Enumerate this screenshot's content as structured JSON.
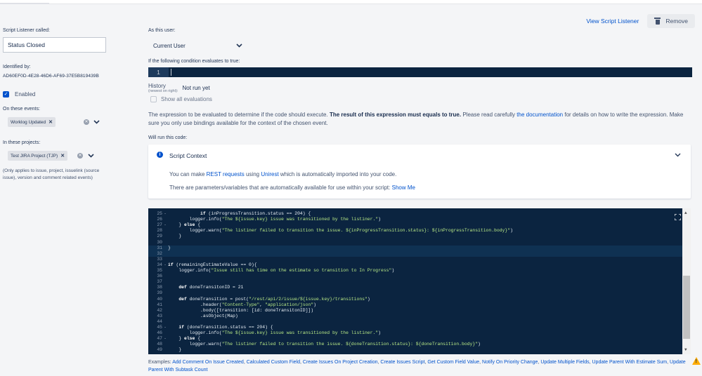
{
  "header": {
    "view_listener": "View Script Listener",
    "remove": "Remove"
  },
  "left": {
    "called_label": "Script Listener called:",
    "called_value": "Status Closed",
    "identified_label": "Identified by:",
    "identified_value": "AD60EF0D-4E28-46D6-AF69-37E5B819439B",
    "enabled_label": "Enabled",
    "events_label": "On these events:",
    "event_chip": "Worklog Updated",
    "projects_label": "In these projects:",
    "project_chip": "Test JIRA Project (TJP)",
    "projects_note": "(Only applies to issue, project, issuelink (source issue), version and comment related events)"
  },
  "main": {
    "user_label": "As this user:",
    "user_value": "Current User",
    "condition_label": "If the following condition evaluates to true:",
    "condition_line": "1",
    "history_label": "History",
    "history_sub": "(newest on right):",
    "history_value": "Not run yet",
    "show_evals": "Show all evaluations",
    "desc_1": "The expression to be evaluated to determine if the code should execute.",
    "desc_bold": "The result of this expression must equals to true.",
    "desc_2": "Please read carefully",
    "desc_link": "the documentation",
    "desc_3": "for details on how to write the expression. Make sure you only use bindings available for the context of the chosen event.",
    "run_label": "Will run this code:"
  },
  "context": {
    "title": "Script Context",
    "line1_a": "You can make",
    "line1_link1": "REST requests",
    "line1_b": "using",
    "line1_link2": "Unirest",
    "line1_c": "which is automatically imported into your code.",
    "line2": "There are parameters/variables that are automatically available for use within your script:",
    "line2_link": "Show Me"
  },
  "code": [
    {
      "n": "25",
      "f": "-",
      "t": "            if (inProgressTransition.status == 204) {"
    },
    {
      "n": "26",
      "f": "",
      "t": "        logger.info(\"The ${issue.key} issue was transitioned by the listiner.\")"
    },
    {
      "n": "27",
      "f": "-",
      "t": "    } else {"
    },
    {
      "n": "28",
      "f": "",
      "t": "        logger.warn(\"The listiner failed to transition the issue. ${inProgressTransition.status}: ${inProgressTransition.body}\")"
    },
    {
      "n": "29",
      "f": "",
      "t": "    }"
    },
    {
      "n": "30",
      "f": "",
      "t": ""
    },
    {
      "n": "31",
      "f": "",
      "t": "}"
    },
    {
      "n": "32",
      "f": "",
      "t": ""
    },
    {
      "n": "33",
      "f": "",
      "t": ""
    },
    {
      "n": "34",
      "f": "-",
      "t": "if (remainingEstimateValue == 0){"
    },
    {
      "n": "35",
      "f": "",
      "t": "    logger.info(\"Issue still has time on the estimate so transition to In Progress\")"
    },
    {
      "n": "36",
      "f": "",
      "t": ""
    },
    {
      "n": "37",
      "f": "",
      "t": ""
    },
    {
      "n": "38",
      "f": "",
      "t": "    def doneTransitonID = 21"
    },
    {
      "n": "39",
      "f": "",
      "t": ""
    },
    {
      "n": "40",
      "f": "",
      "t": "    def doneTransition = post(\"/rest/api/2/issue/${issue.key}/transitions\")"
    },
    {
      "n": "41",
      "f": "",
      "t": "            .header(\"Content-Type\", \"application/json\")"
    },
    {
      "n": "42",
      "f": "",
      "t": "            .body([transition: [id: doneTransitonID]])"
    },
    {
      "n": "43",
      "f": "",
      "t": "            .asObject(Map)"
    },
    {
      "n": "44",
      "f": "",
      "t": ""
    },
    {
      "n": "45",
      "f": "-",
      "t": "    if (doneTransition.status == 204) {"
    },
    {
      "n": "46",
      "f": "",
      "t": "        logger.info(\"The ${issue.key} issue was transitioned by the listiner.\")"
    },
    {
      "n": "47",
      "f": "-",
      "t": "    } else {"
    },
    {
      "n": "48",
      "f": "",
      "t": "        logger.warn(\"The listiner failed to transition the issue. ${doneTransition.status}: ${doneTransition.body}\")"
    },
    {
      "n": "49",
      "f": "",
      "t": "    }"
    }
  ],
  "examples": {
    "prefix": "Examples:",
    "items": [
      "Add Comment On Issue Created",
      "Calculated Custom Field",
      "Create Issues On Project Creation",
      "Create Issues Script",
      "Get Custom Field Value",
      "Notify On Priority Change",
      "Update Multiple Fields",
      "Update Parent With Estimate Sum",
      "Update Parent With Subtask Count"
    ]
  },
  "colors": {
    "accent": "#0052cc",
    "code_bg": "#0b2440",
    "warning": "#ffab00"
  }
}
